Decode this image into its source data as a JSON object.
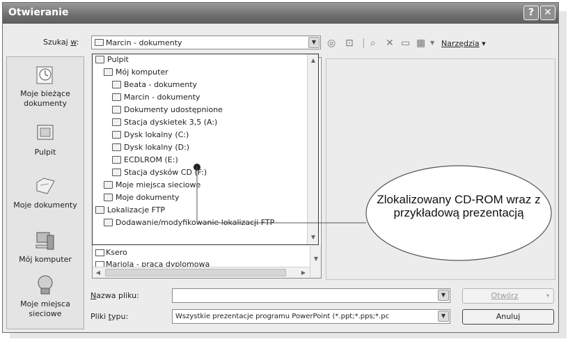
{
  "dialog": {
    "title": "Otwieranie",
    "help_button": "?",
    "close_button": "✕"
  },
  "look_in": {
    "label_prefix": "Szukaj ",
    "label_key": "w",
    "label_suffix": ":",
    "value": "Marcin - dokumenty"
  },
  "toolbar": {
    "tools_label": "Narzędzia"
  },
  "places": [
    {
      "label": "Moje bieżące dokumenty",
      "icon": "recent-documents-icon"
    },
    {
      "label": "Pulpit",
      "icon": "desktop-icon"
    },
    {
      "label": "Moje dokumenty",
      "icon": "my-documents-icon"
    },
    {
      "label": "Mój komputer",
      "icon": "my-computer-icon"
    },
    {
      "label": "Moje miejsca sieciowe",
      "icon": "network-places-icon"
    }
  ],
  "dropdown_items": [
    {
      "label": "Pulpit",
      "level": 0,
      "icon": "desktop-icon"
    },
    {
      "label": "Mój komputer",
      "level": 1,
      "icon": "computer-icon"
    },
    {
      "label": "Beata - dokumenty",
      "level": 2,
      "icon": "folder-icon"
    },
    {
      "label": "Marcin - dokumenty",
      "level": 2,
      "icon": "folder-icon"
    },
    {
      "label": "Dokumenty udostępnione",
      "level": 2,
      "icon": "folder-icon"
    },
    {
      "label": "Stacja dyskietek 3,5 (A:)",
      "level": 2,
      "icon": "floppy-icon"
    },
    {
      "label": "Dysk lokalny (C:)",
      "level": 2,
      "icon": "hard-drive-icon"
    },
    {
      "label": "Dysk lokalny (D:)",
      "level": 2,
      "icon": "hard-drive-icon"
    },
    {
      "label": "ECDLROM (E:)",
      "level": 2,
      "icon": "cd-drive-icon",
      "selected": true
    },
    {
      "label": "Stacja dysków CD (F:)",
      "level": 2,
      "icon": "cd-drive-icon"
    },
    {
      "label": "Moje miejsca sieciowe",
      "level": 1,
      "icon": "network-icon"
    },
    {
      "label": "Moje dokumenty",
      "level": 1,
      "icon": "documents-icon"
    },
    {
      "label": "Lokalizacje FTP",
      "level": 0,
      "icon": "ftp-folder-icon"
    },
    {
      "label": "Dodawanie/modyfikowanie lokalizacji FTP",
      "level": 1,
      "icon": "ftp-add-icon"
    }
  ],
  "file_list": [
    {
      "label": "Ksero"
    },
    {
      "label": "Mariola - praca dyplomowa"
    }
  ],
  "filename": {
    "label_key": "N",
    "label_rest": "azwa pliku:",
    "value": ""
  },
  "filetype": {
    "label_prefix": "Pliki ",
    "label_key": "t",
    "label_rest": "ypu:",
    "value": "Wszystkie prezentacje programu PowerPoint (*.ppt;*.pps;*.pc"
  },
  "buttons": {
    "open": "Otwórz",
    "cancel": "Anuluj"
  },
  "callout": {
    "text": "Zlokalizowany CD-ROM wraz z przykładową prezentacją"
  }
}
